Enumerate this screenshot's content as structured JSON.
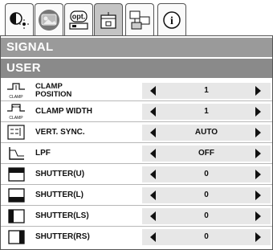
{
  "tabs": [
    {
      "icon": "color-adjust-icon"
    },
    {
      "icon": "image-icon"
    },
    {
      "icon": "options-icon",
      "label": "opt."
    },
    {
      "icon": "signal-icon"
    },
    {
      "icon": "network-icon"
    },
    {
      "icon": "info-icon",
      "label": "i"
    }
  ],
  "sections": {
    "signal": "SIGNAL",
    "user": "USER"
  },
  "rows": [
    {
      "icon": "clamp-position-icon",
      "icon_text": "CLAMP",
      "label_line1": "CLAMP",
      "label_line2": "POSITION",
      "value": "1"
    },
    {
      "icon": "clamp-width-icon",
      "icon_text": "CLAMP",
      "label": "CLAMP WIDTH",
      "value": "1"
    },
    {
      "icon": "vert-sync-icon",
      "label": "VERT. SYNC.",
      "value": "AUTO"
    },
    {
      "icon": "lpf-icon",
      "label": "LPF",
      "value": "OFF"
    },
    {
      "icon": "shutter-u-icon",
      "label": "SHUTTER(U)",
      "value": "0"
    },
    {
      "icon": "shutter-l-icon",
      "label": "SHUTTER(L)",
      "value": "0"
    },
    {
      "icon": "shutter-ls-icon",
      "label": "SHUTTER(LS)",
      "value": "0"
    },
    {
      "icon": "shutter-rs-icon",
      "label": "SHUTTER(RS)",
      "value": "0"
    }
  ],
  "colors": {
    "section_bg": "#8a8a8a",
    "active_tab": "#c4c4c4",
    "control_bg": "#e7e7e7"
  }
}
